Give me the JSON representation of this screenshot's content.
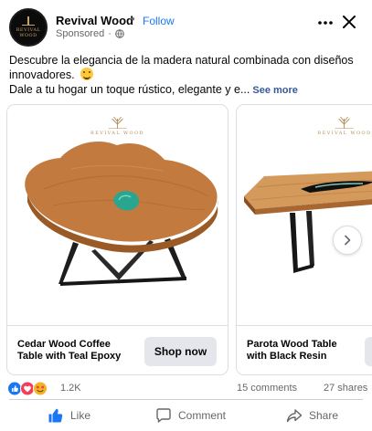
{
  "header": {
    "page_name": "Revival Wood",
    "separator": "•",
    "follow_label": "Follow",
    "sponsored_label": "Sponsored",
    "sponsored_separator": "·",
    "avatar_text": "REVIVAL WOOD",
    "more_icon": "more-horizontal-icon",
    "close_icon": "close-icon"
  },
  "caption": {
    "line1": "Descubre la elegancia de la madera natural combinada con diseños",
    "line2": "innovadores.",
    "line3": "Dale a tu hogar un toque rústico, elegante y e...",
    "see_more": "See more"
  },
  "carousel": {
    "cards": [
      {
        "brand": "REVIVAL WOOD",
        "title": "Cedar Wood Coffee Table with Teal Epoxy",
        "cta": "Shop now"
      },
      {
        "brand": "REVIVAL WOOD",
        "title": "Parota Wood Table with Black Resin",
        "cta": ""
      }
    ]
  },
  "stats": {
    "reactions": "1.2K",
    "comments": "15 comments",
    "shares": "27 shares"
  },
  "actions": {
    "like": "Like",
    "comment": "Comment",
    "share": "Share"
  },
  "colors": {
    "accent": "#1877f2",
    "secondary_text": "#65676b",
    "wood": "#c27a3f",
    "epoxy": "#2aa58f"
  }
}
